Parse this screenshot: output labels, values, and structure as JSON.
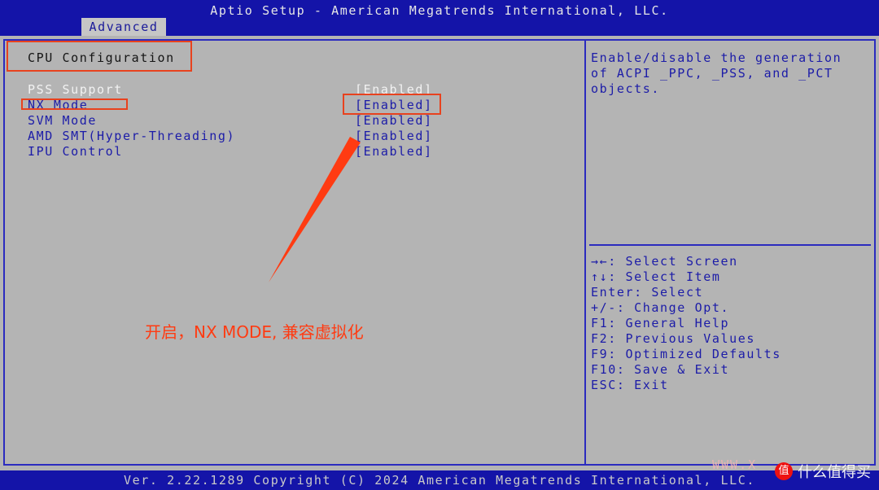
{
  "header": {
    "title": "Aptio Setup - American Megatrends International, LLC.",
    "active_tab": "Advanced"
  },
  "section_title": "CPU Configuration",
  "settings": [
    {
      "label": "PSS Support",
      "value": "[Enabled]"
    },
    {
      "label": "NX Mode",
      "value": "[Enabled]"
    },
    {
      "label": "SVM Mode",
      "value": "[Enabled]"
    },
    {
      "label": "AMD SMT(Hyper-Threading)",
      "value": "[Enabled]"
    },
    {
      "label": "IPU Control",
      "value": "[Enabled]"
    }
  ],
  "help": {
    "description": [
      "Enable/disable the generation",
      "of ACPI _PPC, _PSS, and _PCT",
      "objects."
    ],
    "keys": [
      "→←: Select Screen",
      "↑↓: Select Item",
      "Enter: Select",
      "+/-: Change Opt.",
      "F1: General Help",
      "F2: Previous Values",
      "F9: Optimized Defaults",
      "F10: Save & Exit",
      "ESC: Exit"
    ]
  },
  "footer": {
    "text": "Ver. 2.22.1289 Copyright (C) 2024 American Megatrends International, LLC."
  },
  "annotation": {
    "text": "开启，NX MODE, 兼容虚拟化"
  },
  "watermark": {
    "url": "WWW.X",
    "icon_char": "值",
    "brand": "什么值得买"
  },
  "colors": {
    "bios_blue": "#1414a8",
    "panel_gray": "#b4b4b4",
    "annotation_red": "#ff3b12"
  }
}
